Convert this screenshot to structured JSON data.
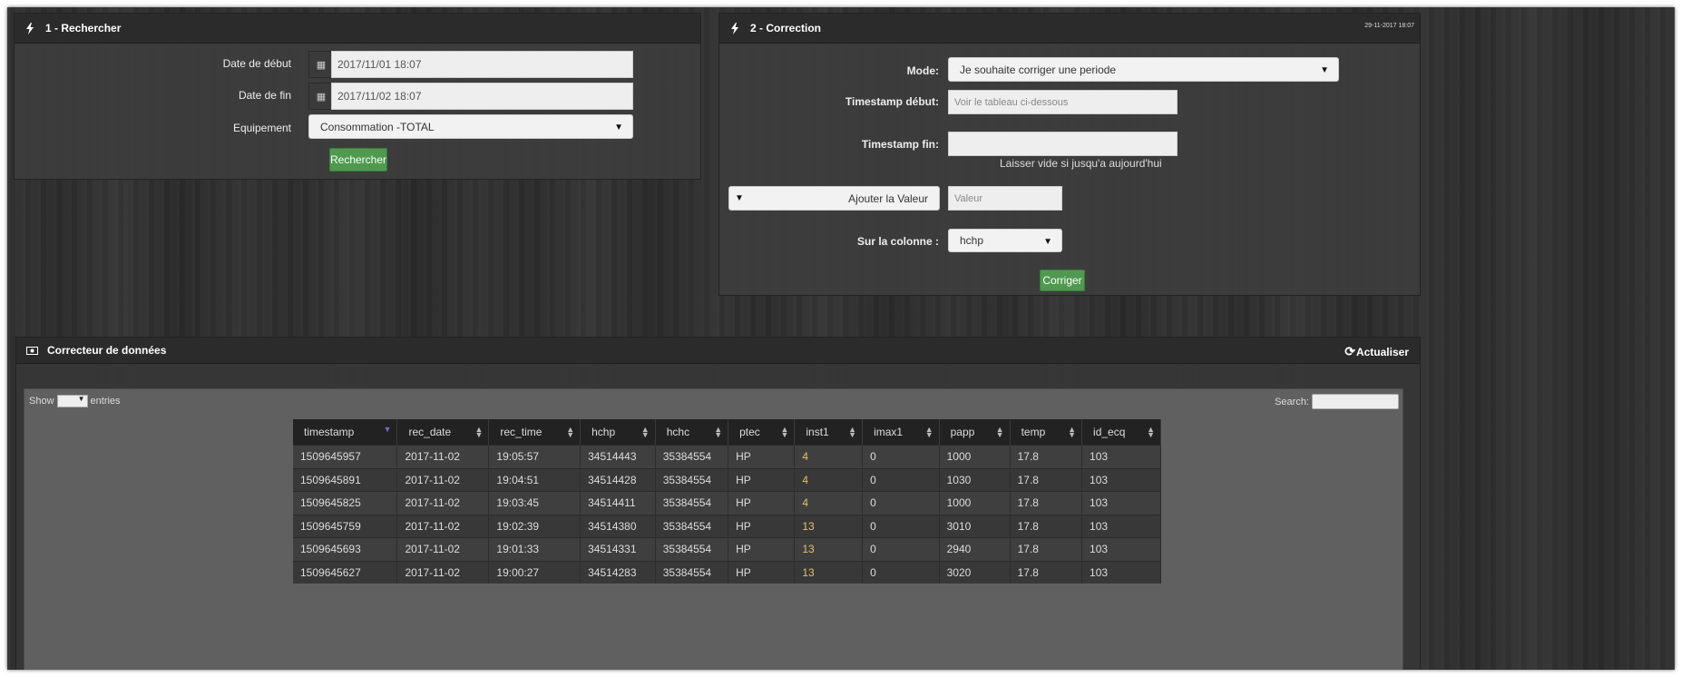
{
  "search_panel": {
    "title": "1 - Rechercher",
    "date_debut_label": "Date de début",
    "date_debut_value": "2017/11/01 18:07",
    "date_fin_label": "Date de fin",
    "date_fin_value": "2017/11/02 18:07",
    "equipement_label": "Equipement",
    "equipement_value": "Consommation -TOTAL",
    "submit_label": "Rechercher"
  },
  "correction_panel": {
    "title": "2 - Correction",
    "date_stamp": "29-11-2017 18:07",
    "mode_label": "Mode:",
    "mode_value": "Je souhaite corriger une periode",
    "ts_debut_label": "Timestamp début:",
    "ts_debut_placeholder": "Voir le tableau ci-dessous",
    "ts_fin_label": "Timestamp fin:",
    "ts_fin_value": "",
    "ts_fin_help": "Laisser vide si jusqu'a aujourd'hui",
    "operation_value": "Ajouter la Valeur",
    "valeur_placeholder": "Valeur",
    "colonne_label": "Sur la colonne :",
    "colonne_value": "hchp",
    "submit_label": "Corriger"
  },
  "data_panel": {
    "title": "Correcteur de données",
    "refresh_label": "Actualiser",
    "show_label": "Show",
    "entries_label": "entries",
    "search_label": "Search:",
    "columns": [
      "timestamp",
      "rec_date",
      "rec_time",
      "hchp",
      "hchc",
      "ptec",
      "inst1",
      "imax1",
      "papp",
      "temp",
      "id_ecq"
    ],
    "rows": [
      [
        "1509645957",
        "2017-11-02",
        "19:05:57",
        "34514443",
        "35384554",
        "HP",
        "4",
        "0",
        "1000",
        "17.8",
        "103"
      ],
      [
        "1509645891",
        "2017-11-02",
        "19:04:51",
        "34514428",
        "35384554",
        "HP",
        "4",
        "0",
        "1030",
        "17.8",
        "103"
      ],
      [
        "1509645825",
        "2017-11-02",
        "19:03:45",
        "34514411",
        "35384554",
        "HP",
        "4",
        "0",
        "1000",
        "17.8",
        "103"
      ],
      [
        "1509645759",
        "2017-11-02",
        "19:02:39",
        "34514380",
        "35384554",
        "HP",
        "13",
        "0",
        "3010",
        "17.8",
        "103"
      ],
      [
        "1509645693",
        "2017-11-02",
        "19:01:33",
        "34514331",
        "35384554",
        "HP",
        "13",
        "0",
        "2940",
        "17.8",
        "103"
      ],
      [
        "1509645627",
        "2017-11-02",
        "19:00:27",
        "34514283",
        "35384554",
        "HP",
        "13",
        "0",
        "3020",
        "17.8",
        "103"
      ]
    ]
  },
  "colors": {
    "accent_green": "#4e9a4e",
    "highlight": "#e8c25a"
  }
}
